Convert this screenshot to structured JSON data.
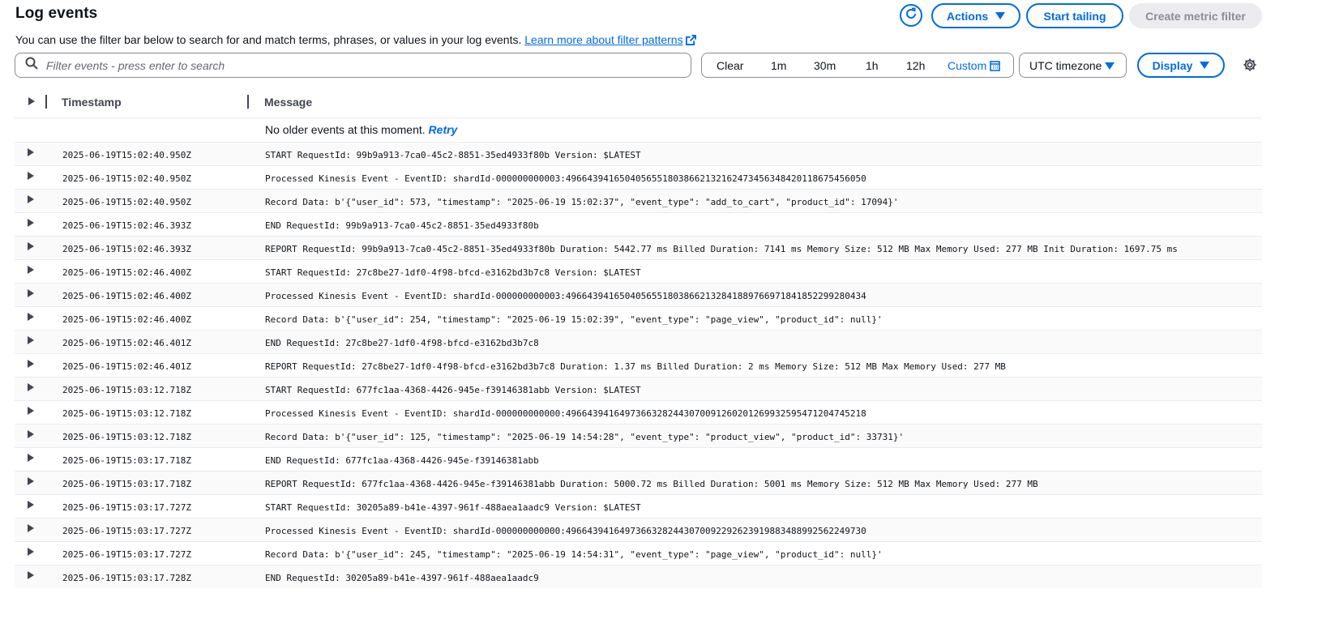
{
  "header": {
    "title": "Log events",
    "description": "You can use the filter bar below to search for and match terms, phrases, or values in your log events.",
    "learn_more": "Learn more about filter patterns"
  },
  "toolbar": {
    "actions_label": "Actions",
    "start_tailing_label": "Start tailing",
    "create_metric_filter_label": "Create metric filter"
  },
  "search": {
    "placeholder": "Filter events - press enter to search"
  },
  "time_range": {
    "clear": "Clear",
    "options": [
      "1m",
      "30m",
      "1h",
      "12h"
    ],
    "custom": "Custom"
  },
  "timezone": {
    "selected": "UTC timezone"
  },
  "display_label": "Display",
  "table": {
    "col_timestamp": "Timestamp",
    "col_message": "Message",
    "no_older_text": "No older events at this moment.",
    "retry_label": "Retry",
    "rows": [
      {
        "ts": "2025-06-19T15:02:40.950Z",
        "msg": "START RequestId: 99b9a913-7ca0-45c2-8851-35ed4933f80b Version: $LATEST"
      },
      {
        "ts": "2025-06-19T15:02:40.950Z",
        "msg": "Processed Kinesis Event - EventID: shardId-000000000003:49664394165040565518038662132162473456348420118675456050"
      },
      {
        "ts": "2025-06-19T15:02:40.950Z",
        "msg": "Record Data: b'{\"user_id\": 573, \"timestamp\": \"2025-06-19 15:02:37\", \"event_type\": \"add_to_cart\", \"product_id\": 17094}'"
      },
      {
        "ts": "2025-06-19T15:02:46.393Z",
        "msg": "END RequestId: 99b9a913-7ca0-45c2-8851-35ed4933f80b"
      },
      {
        "ts": "2025-06-19T15:02:46.393Z",
        "msg": "REPORT RequestId: 99b9a913-7ca0-45c2-8851-35ed4933f80b Duration: 5442.77 ms Billed Duration: 7141 ms Memory Size: 512 MB Max Memory Used: 277 MB Init Duration: 1697.75 ms"
      },
      {
        "ts": "2025-06-19T15:02:46.400Z",
        "msg": "START RequestId: 27c8be27-1df0-4f98-bfcd-e3162bd3b7c8 Version: $LATEST"
      },
      {
        "ts": "2025-06-19T15:02:46.400Z",
        "msg": "Processed Kinesis Event - EventID: shardId-000000000003:49664394165040565518038662132841889766971841852299280434"
      },
      {
        "ts": "2025-06-19T15:02:46.400Z",
        "msg": "Record Data: b'{\"user_id\": 254, \"timestamp\": \"2025-06-19 15:02:39\", \"event_type\": \"page_view\", \"product_id\": null}'"
      },
      {
        "ts": "2025-06-19T15:02:46.401Z",
        "msg": "END RequestId: 27c8be27-1df0-4f98-bfcd-e3162bd3b7c8"
      },
      {
        "ts": "2025-06-19T15:02:46.401Z",
        "msg": "REPORT RequestId: 27c8be27-1df0-4f98-bfcd-e3162bd3b7c8 Duration: 1.37 ms Billed Duration: 2 ms Memory Size: 512 MB Max Memory Used: 277 MB"
      },
      {
        "ts": "2025-06-19T15:03:12.718Z",
        "msg": "START RequestId: 677fc1aa-4368-4426-945e-f39146381abb Version: $LATEST"
      },
      {
        "ts": "2025-06-19T15:03:12.718Z",
        "msg": "Processed Kinesis Event - EventID: shardId-000000000000:49664394164973663282443070091260201269932595471204745218"
      },
      {
        "ts": "2025-06-19T15:03:12.718Z",
        "msg": "Record Data: b'{\"user_id\": 125, \"timestamp\": \"2025-06-19 14:54:28\", \"event_type\": \"product_view\", \"product_id\": 33731}'"
      },
      {
        "ts": "2025-06-19T15:03:17.718Z",
        "msg": "END RequestId: 677fc1aa-4368-4426-945e-f39146381abb"
      },
      {
        "ts": "2025-06-19T15:03:17.718Z",
        "msg": "REPORT RequestId: 677fc1aa-4368-4426-945e-f39146381abb Duration: 5000.72 ms Billed Duration: 5001 ms Memory Size: 512 MB Max Memory Used: 277 MB"
      },
      {
        "ts": "2025-06-19T15:03:17.727Z",
        "msg": "START RequestId: 30205a89-b41e-4397-961f-488aea1aadc9 Version: $LATEST"
      },
      {
        "ts": "2025-06-19T15:03:17.727Z",
        "msg": "Processed Kinesis Event - EventID: shardId-000000000000:49664394164973663282443070092292623919883488992562249730"
      },
      {
        "ts": "2025-06-19T15:03:17.727Z",
        "msg": "Record Data: b'{\"user_id\": 245, \"timestamp\": \"2025-06-19 14:54:31\", \"event_type\": \"page_view\", \"product_id\": null}'"
      },
      {
        "ts": "2025-06-19T15:03:17.728Z",
        "msg": "END RequestId: 30205a89-b41e-4397-961f-488aea1aadc9"
      }
    ]
  }
}
